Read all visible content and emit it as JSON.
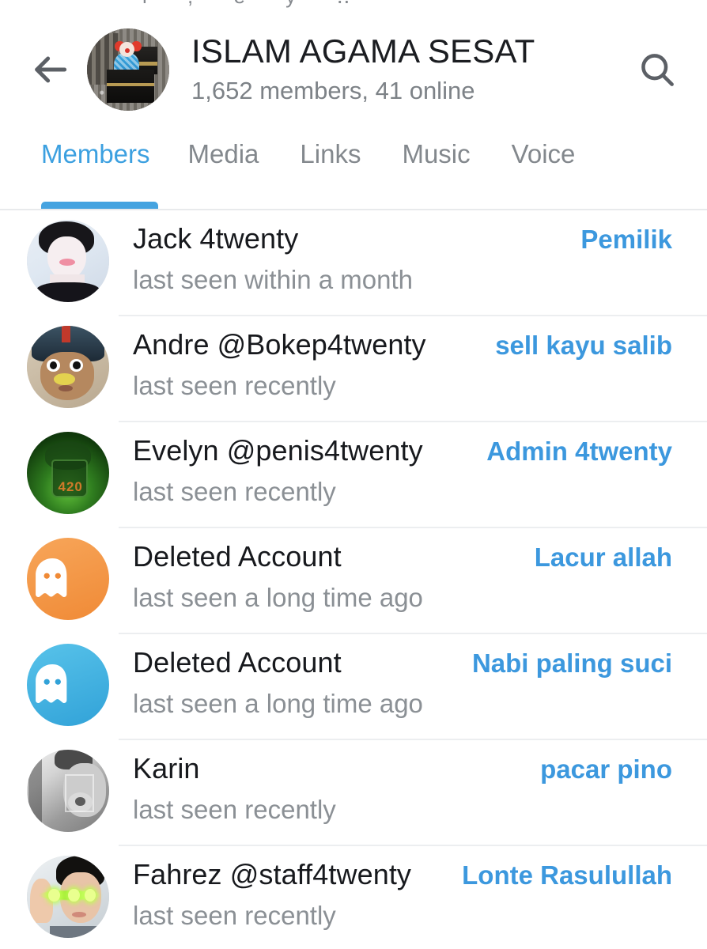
{
  "header": {
    "back_icon": "back-arrow-icon",
    "search_icon": "search-icon",
    "avatar_icon": "group-avatar-photo",
    "title": "ISLAM AGAMA SESAT",
    "subtitle": "1,652 members, 41 online"
  },
  "tabs": {
    "items": [
      {
        "label": "Members",
        "active": true
      },
      {
        "label": "Media",
        "active": false
      },
      {
        "label": "Links",
        "active": false
      },
      {
        "label": "Music",
        "active": false
      },
      {
        "label": "Voice",
        "active": false
      }
    ]
  },
  "colors": {
    "accent_blue": "#3c98de",
    "tab_active": "#3ca0e0",
    "tab_inactive": "#83888d",
    "name_text": "#17191d",
    "status_text": "#8b9095",
    "divider": "#eceef0",
    "ghost_orange": "#f08a36",
    "ghost_blue": "#31a2d8"
  },
  "members": [
    {
      "name": "Jack 4twenty",
      "status": "last seen within a month",
      "role": "Pemilik",
      "avatar_type": "photo-jack"
    },
    {
      "name": "Andre @Bokep4twenty",
      "status": "last seen recently",
      "role": "sell kayu salib",
      "avatar_type": "photo-andre"
    },
    {
      "name": "Evelyn @penis4twenty",
      "status": "last seen recently",
      "role": "Admin 4twenty",
      "avatar_type": "photo-evelyn"
    },
    {
      "name": "Deleted Account",
      "status": "last seen a long time ago",
      "role": "Lacur allah",
      "avatar_type": "ghost-orange"
    },
    {
      "name": "Deleted Account",
      "status": "last seen a long time ago",
      "role": "Nabi paling suci",
      "avatar_type": "ghost-blue"
    },
    {
      "name": "Karin",
      "status": "last seen recently",
      "role": "pacar pino",
      "avatar_type": "photo-karin"
    },
    {
      "name": "Fahrez @staff4twenty",
      "status": "last seen recently",
      "role": "Lonte Rasulullah",
      "avatar_type": "photo-fahrez"
    }
  ]
}
